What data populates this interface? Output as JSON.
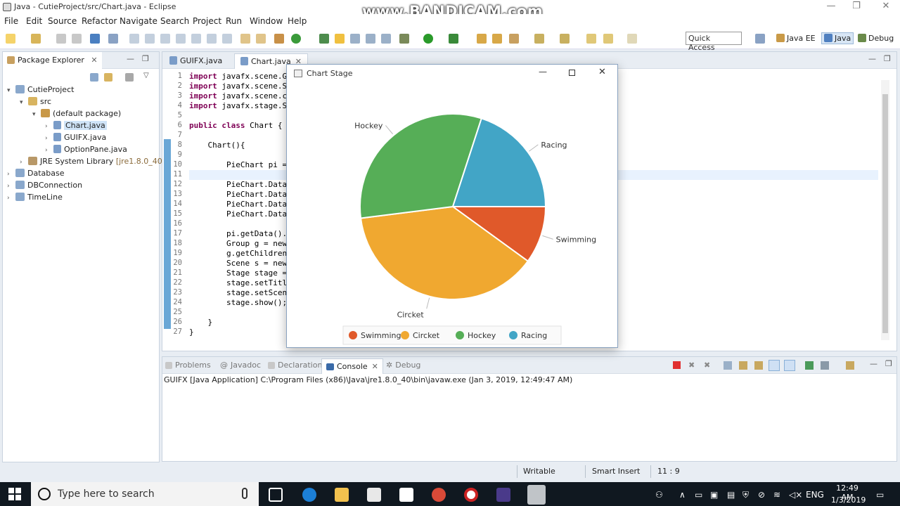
{
  "window": {
    "title": "Java - CutieProject/src/Chart.java - Eclipse",
    "minimize": "—",
    "maximize": "❐",
    "close": "✕"
  },
  "watermark": "www.BANDICAM.com",
  "menu": [
    "File",
    "Edit",
    "Source",
    "Refactor",
    "Navigate",
    "Search",
    "Project",
    "Run",
    "Window",
    "Help"
  ],
  "toolbar": {
    "quick_access_placeholder": "Quick Access",
    "perspectives": [
      "Java EE",
      "Java",
      "Debug"
    ]
  },
  "package_explorer": {
    "title": "Package Explorer",
    "tree": [
      {
        "label": "CutieProject",
        "depth": 0,
        "expanded": true
      },
      {
        "label": "src",
        "depth": 1,
        "expanded": true
      },
      {
        "label": "(default package)",
        "depth": 2,
        "expanded": true
      },
      {
        "label": "Chart.java",
        "depth": 3,
        "selected": true
      },
      {
        "label": "GUIFX.java",
        "depth": 3
      },
      {
        "label": "OptionPane.java",
        "depth": 3
      },
      {
        "label": "JRE System Library",
        "suffix": "[jre1.8.0_40]",
        "depth": 1
      },
      {
        "label": "Database",
        "depth": 0
      },
      {
        "label": "DBConnection",
        "depth": 0
      },
      {
        "label": "TimeLine",
        "depth": 0
      }
    ]
  },
  "editor": {
    "tabs": [
      "GUIFX.java",
      "Chart.java"
    ],
    "active_tab": "Chart.java",
    "line_numbers": [
      "1",
      "2",
      "3",
      "4",
      "5",
      "6",
      "7",
      "8",
      "9",
      "10",
      "11",
      "12",
      "13",
      "14",
      "15",
      "16",
      "17",
      "18",
      "19",
      "20",
      "21",
      "22",
      "23",
      "24",
      "25",
      "26",
      "27"
    ],
    "lines": [
      [
        "import",
        " javafx.scene.G"
      ],
      [
        "import",
        " javafx.scene.S"
      ],
      [
        "import",
        " javafx.scene.c"
      ],
      [
        "import",
        " javafx.stage.S"
      ],
      [
        "",
        ""
      ],
      [
        "public class",
        " Chart {"
      ],
      [
        "",
        ""
      ],
      [
        "",
        "    Chart(){"
      ],
      [
        "",
        ""
      ],
      [
        "",
        "        PieChart pi ="
      ],
      [
        "",
        ""
      ],
      [
        "",
        "        PieChart.Data"
      ],
      [
        "",
        "        PieChart.Data"
      ],
      [
        "",
        "        PieChart.Data"
      ],
      [
        "",
        "        PieChart.Data"
      ],
      [
        "",
        ""
      ],
      [
        "",
        "        pi.getData()."
      ],
      [
        "",
        "        Group g = new"
      ],
      [
        "",
        "        g.getChildren"
      ],
      [
        "",
        "        Scene s = new"
      ],
      [
        "",
        "        Stage stage ="
      ],
      [
        "",
        "        stage.setTitl"
      ],
      [
        "",
        "        stage.setScen"
      ],
      [
        "",
        "        stage.show();"
      ],
      [
        "",
        ""
      ],
      [
        "",
        "    }"
      ],
      [
        "",
        "}"
      ]
    ]
  },
  "console": {
    "tabs": [
      "Problems",
      "Javadoc",
      "Declaration",
      "Console",
      "Debug"
    ],
    "active_tab": "Console",
    "line": "GUIFX [Java Application] C:\\Program Files (x86)\\Java\\jre1.8.0_40\\bin\\javaw.exe (Jan 3, 2019, 12:49:47 AM)"
  },
  "statusbar": {
    "writable": "Writable",
    "insert_mode": "Smart Insert",
    "position": "11 : 9"
  },
  "taskbar": {
    "search_placeholder": "Type here to search",
    "language": "ENG",
    "time": "12:49 AM",
    "date": "1/3/2019"
  },
  "chart_window": {
    "title": "Chart Stage"
  },
  "chart_data": {
    "type": "pie",
    "title": "",
    "categories": [
      "Swimming",
      "Circket",
      "Hockey",
      "Racing"
    ],
    "values": [
      10,
      38,
      32,
      20
    ],
    "colors": [
      "#e0592a",
      "#f0a830",
      "#56ae57",
      "#42a5c6"
    ],
    "legend": "bottom"
  },
  "colors": {
    "keyword": "#7f0055",
    "accent": "#2a6fb5"
  }
}
